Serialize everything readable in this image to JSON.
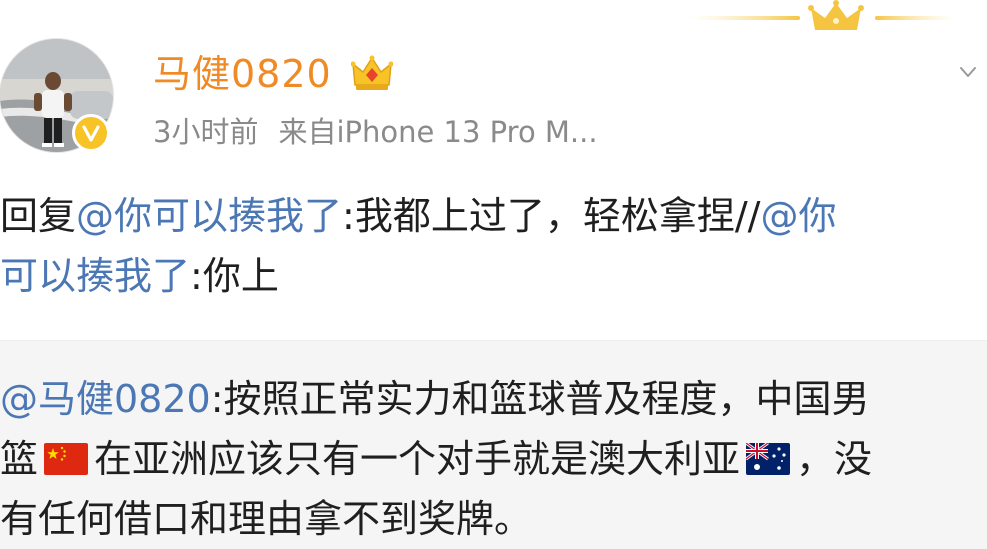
{
  "post": {
    "username": "马健0820",
    "time": "3小时前",
    "source": "来自iPhone 13 Pro M...",
    "main_text": {
      "line1_prefix": "回复",
      "line1_mention": "@你可以揍我了",
      "line1_rest": ":我都上过了，轻松拿捏//",
      "line1_mention2": "@你",
      "line2_mention": "可以揍我了",
      "line2_rest": ":你上"
    },
    "repost": {
      "mention": "@马健0820",
      "line1_rest": ":按照正常实力和篮球普及程度，中国男",
      "line2_a": "篮",
      "line2_b": "在亚洲应该只有一个对手就是澳大利亚",
      "line2_c": "，没",
      "line3": "有任何借口和理由拿不到奖牌。"
    },
    "icons": {
      "avatar": "user-avatar",
      "verified": "verified-badge-icon",
      "vip": "vip-crown-icon",
      "china_flag": "china-flag-icon",
      "australia_flag": "australia-flag-icon",
      "more": "chevron-down-icon",
      "banner": "crown-banner-icon"
    },
    "colors": {
      "username": "#f08a24",
      "mention": "#4b77b5",
      "meta": "#8a8a8a",
      "repost_bg": "#f5f5f5",
      "verified": "#f7c326"
    }
  }
}
